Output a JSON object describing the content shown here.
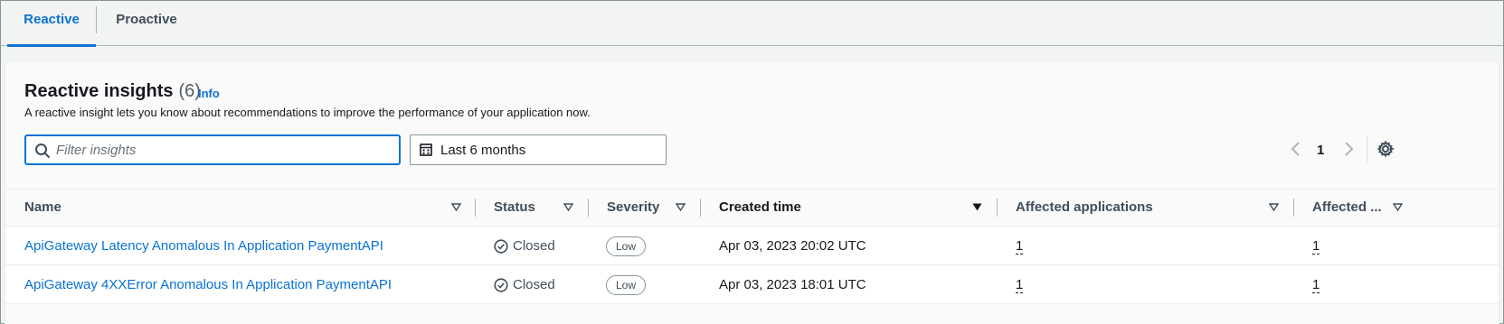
{
  "tabs": [
    {
      "label": "Reactive",
      "active": true
    },
    {
      "label": "Proactive",
      "active": false
    }
  ],
  "header": {
    "title": "Reactive insights",
    "count": "(6)",
    "info_label": "Info",
    "description": "A reactive insight lets you know about recommendations to improve the performance of your application now."
  },
  "filter": {
    "placeholder": "Filter insights",
    "value": ""
  },
  "date_range": {
    "label": "Last 6 months"
  },
  "pagination": {
    "current_page": "1"
  },
  "table": {
    "columns": [
      {
        "label": "Name",
        "sort": "none"
      },
      {
        "label": "Status",
        "sort": "none"
      },
      {
        "label": "Severity",
        "sort": "none"
      },
      {
        "label": "Created time",
        "sort": "descending"
      },
      {
        "label": "Affected applications",
        "sort": "none"
      },
      {
        "label": "Affected ...",
        "sort": "none"
      }
    ],
    "rows": [
      {
        "name": "ApiGateway Latency Anomalous In Application PaymentAPI",
        "status": "Closed",
        "severity": "Low",
        "created": "Apr 03, 2023 20:02 UTC",
        "affected_applications": "1",
        "affected_other": "1"
      },
      {
        "name": "ApiGateway 4XXError Anomalous In Application PaymentAPI",
        "status": "Closed",
        "severity": "Low",
        "created": "Apr 03, 2023 18:01 UTC",
        "affected_applications": "1",
        "affected_other": "1"
      }
    ]
  },
  "colors": {
    "link": "#0972d3",
    "text": "#16191f",
    "muted": "#414d5c",
    "background": "#f2f3f3"
  },
  "icons": [
    "search-icon",
    "calendar-icon",
    "chevron-left-icon",
    "chevron-right-icon",
    "gear-icon",
    "sort-icon",
    "check-circle-icon"
  ]
}
